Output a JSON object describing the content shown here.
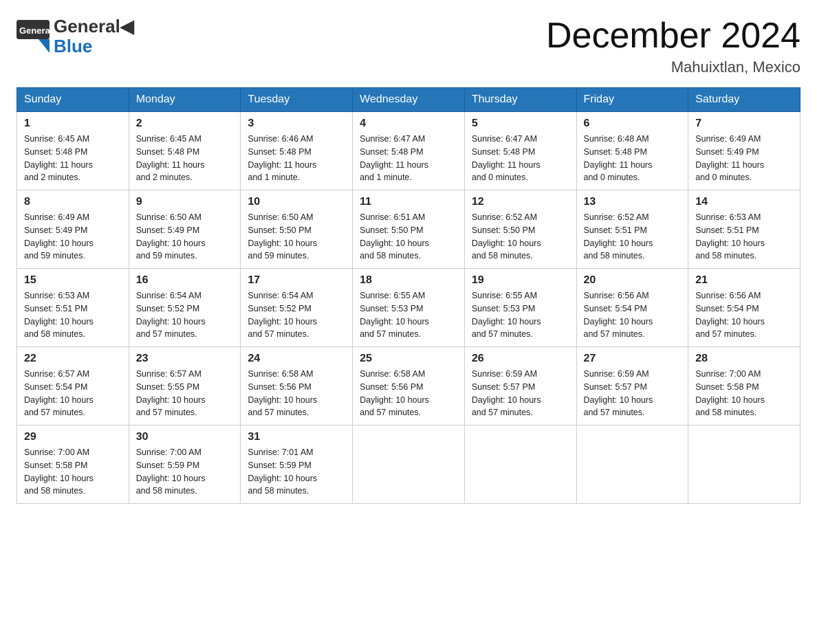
{
  "header": {
    "logo_general": "General",
    "logo_blue": "Blue",
    "title": "December 2024",
    "location": "Mahuixtlan, Mexico"
  },
  "weekdays": [
    "Sunday",
    "Monday",
    "Tuesday",
    "Wednesday",
    "Thursday",
    "Friday",
    "Saturday"
  ],
  "weeks": [
    [
      {
        "day": "1",
        "sunrise": "6:45 AM",
        "sunset": "5:48 PM",
        "daylight": "11 hours and 2 minutes."
      },
      {
        "day": "2",
        "sunrise": "6:45 AM",
        "sunset": "5:48 PM",
        "daylight": "11 hours and 2 minutes."
      },
      {
        "day": "3",
        "sunrise": "6:46 AM",
        "sunset": "5:48 PM",
        "daylight": "11 hours and 1 minute."
      },
      {
        "day": "4",
        "sunrise": "6:47 AM",
        "sunset": "5:48 PM",
        "daylight": "11 hours and 1 minute."
      },
      {
        "day": "5",
        "sunrise": "6:47 AM",
        "sunset": "5:48 PM",
        "daylight": "11 hours and 0 minutes."
      },
      {
        "day": "6",
        "sunrise": "6:48 AM",
        "sunset": "5:48 PM",
        "daylight": "11 hours and 0 minutes."
      },
      {
        "day": "7",
        "sunrise": "6:49 AM",
        "sunset": "5:49 PM",
        "daylight": "11 hours and 0 minutes."
      }
    ],
    [
      {
        "day": "8",
        "sunrise": "6:49 AM",
        "sunset": "5:49 PM",
        "daylight": "10 hours and 59 minutes."
      },
      {
        "day": "9",
        "sunrise": "6:50 AM",
        "sunset": "5:49 PM",
        "daylight": "10 hours and 59 minutes."
      },
      {
        "day": "10",
        "sunrise": "6:50 AM",
        "sunset": "5:50 PM",
        "daylight": "10 hours and 59 minutes."
      },
      {
        "day": "11",
        "sunrise": "6:51 AM",
        "sunset": "5:50 PM",
        "daylight": "10 hours and 58 minutes."
      },
      {
        "day": "12",
        "sunrise": "6:52 AM",
        "sunset": "5:50 PM",
        "daylight": "10 hours and 58 minutes."
      },
      {
        "day": "13",
        "sunrise": "6:52 AM",
        "sunset": "5:51 PM",
        "daylight": "10 hours and 58 minutes."
      },
      {
        "day": "14",
        "sunrise": "6:53 AM",
        "sunset": "5:51 PM",
        "daylight": "10 hours and 58 minutes."
      }
    ],
    [
      {
        "day": "15",
        "sunrise": "6:53 AM",
        "sunset": "5:51 PM",
        "daylight": "10 hours and 58 minutes."
      },
      {
        "day": "16",
        "sunrise": "6:54 AM",
        "sunset": "5:52 PM",
        "daylight": "10 hours and 57 minutes."
      },
      {
        "day": "17",
        "sunrise": "6:54 AM",
        "sunset": "5:52 PM",
        "daylight": "10 hours and 57 minutes."
      },
      {
        "day": "18",
        "sunrise": "6:55 AM",
        "sunset": "5:53 PM",
        "daylight": "10 hours and 57 minutes."
      },
      {
        "day": "19",
        "sunrise": "6:55 AM",
        "sunset": "5:53 PM",
        "daylight": "10 hours and 57 minutes."
      },
      {
        "day": "20",
        "sunrise": "6:56 AM",
        "sunset": "5:54 PM",
        "daylight": "10 hours and 57 minutes."
      },
      {
        "day": "21",
        "sunrise": "6:56 AM",
        "sunset": "5:54 PM",
        "daylight": "10 hours and 57 minutes."
      }
    ],
    [
      {
        "day": "22",
        "sunrise": "6:57 AM",
        "sunset": "5:54 PM",
        "daylight": "10 hours and 57 minutes."
      },
      {
        "day": "23",
        "sunrise": "6:57 AM",
        "sunset": "5:55 PM",
        "daylight": "10 hours and 57 minutes."
      },
      {
        "day": "24",
        "sunrise": "6:58 AM",
        "sunset": "5:56 PM",
        "daylight": "10 hours and 57 minutes."
      },
      {
        "day": "25",
        "sunrise": "6:58 AM",
        "sunset": "5:56 PM",
        "daylight": "10 hours and 57 minutes."
      },
      {
        "day": "26",
        "sunrise": "6:59 AM",
        "sunset": "5:57 PM",
        "daylight": "10 hours and 57 minutes."
      },
      {
        "day": "27",
        "sunrise": "6:59 AM",
        "sunset": "5:57 PM",
        "daylight": "10 hours and 57 minutes."
      },
      {
        "day": "28",
        "sunrise": "7:00 AM",
        "sunset": "5:58 PM",
        "daylight": "10 hours and 58 minutes."
      }
    ],
    [
      {
        "day": "29",
        "sunrise": "7:00 AM",
        "sunset": "5:58 PM",
        "daylight": "10 hours and 58 minutes."
      },
      {
        "day": "30",
        "sunrise": "7:00 AM",
        "sunset": "5:59 PM",
        "daylight": "10 hours and 58 minutes."
      },
      {
        "day": "31",
        "sunrise": "7:01 AM",
        "sunset": "5:59 PM",
        "daylight": "10 hours and 58 minutes."
      },
      null,
      null,
      null,
      null
    ]
  ],
  "labels": {
    "sunrise": "Sunrise:",
    "sunset": "Sunset:",
    "daylight": "Daylight:"
  }
}
